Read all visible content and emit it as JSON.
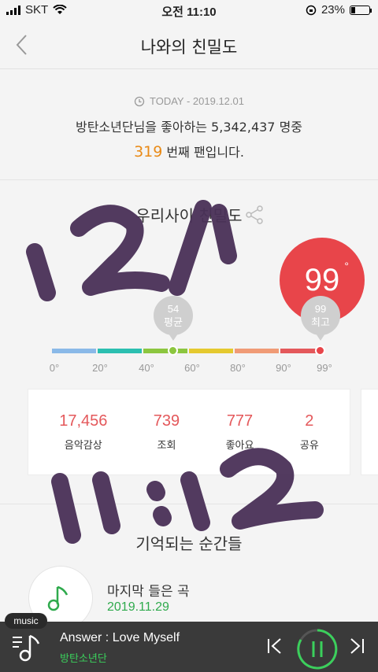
{
  "status_bar": {
    "carrier": "SKT",
    "time": "오전 11:10",
    "battery": "23%",
    "battery_level": 0.23
  },
  "header": {
    "title": "나와의 친밀도"
  },
  "today": {
    "date": "TODAY - 2019.12.01",
    "fan_line": "방탄소년단님을 좋아하는 5,342,437 명중",
    "rank": "319",
    "rank_suffix": "번째 팬입니다."
  },
  "intimacy": {
    "title": "우리사이 친밀도",
    "score": "99",
    "score_unit": "°",
    "average_value": "54",
    "average_label": "평균",
    "max_value": "99",
    "max_label": "최고",
    "scale_ticks": [
      "0°",
      "20°",
      "40°",
      "60°",
      "80°",
      "90°",
      "99°"
    ],
    "segment_colors": [
      "#8ab9e8",
      "#2cbfb0",
      "#8cc63f",
      "#e5c92f",
      "#f09b76",
      "#e4585b"
    ],
    "average_marker_color": "#8cc63f",
    "score_marker_color": "#e8454a"
  },
  "stats": [
    {
      "value": "17,456",
      "label": "음악감상"
    },
    {
      "value": "739",
      "label": "조회"
    },
    {
      "value": "777",
      "label": "좋아요"
    },
    {
      "value": "2",
      "label": "공유"
    }
  ],
  "moments": {
    "title": "기억되는 순간들",
    "last_label": "마지막 들은 곡",
    "last_date": "2019.11.29"
  },
  "player": {
    "tag": "music",
    "song": "Answer : Love Myself",
    "artist": "방탄소년단",
    "accent": "#3bd05c"
  },
  "handwriting": {
    "lines": [
      "12/1",
      "11:12"
    ]
  }
}
